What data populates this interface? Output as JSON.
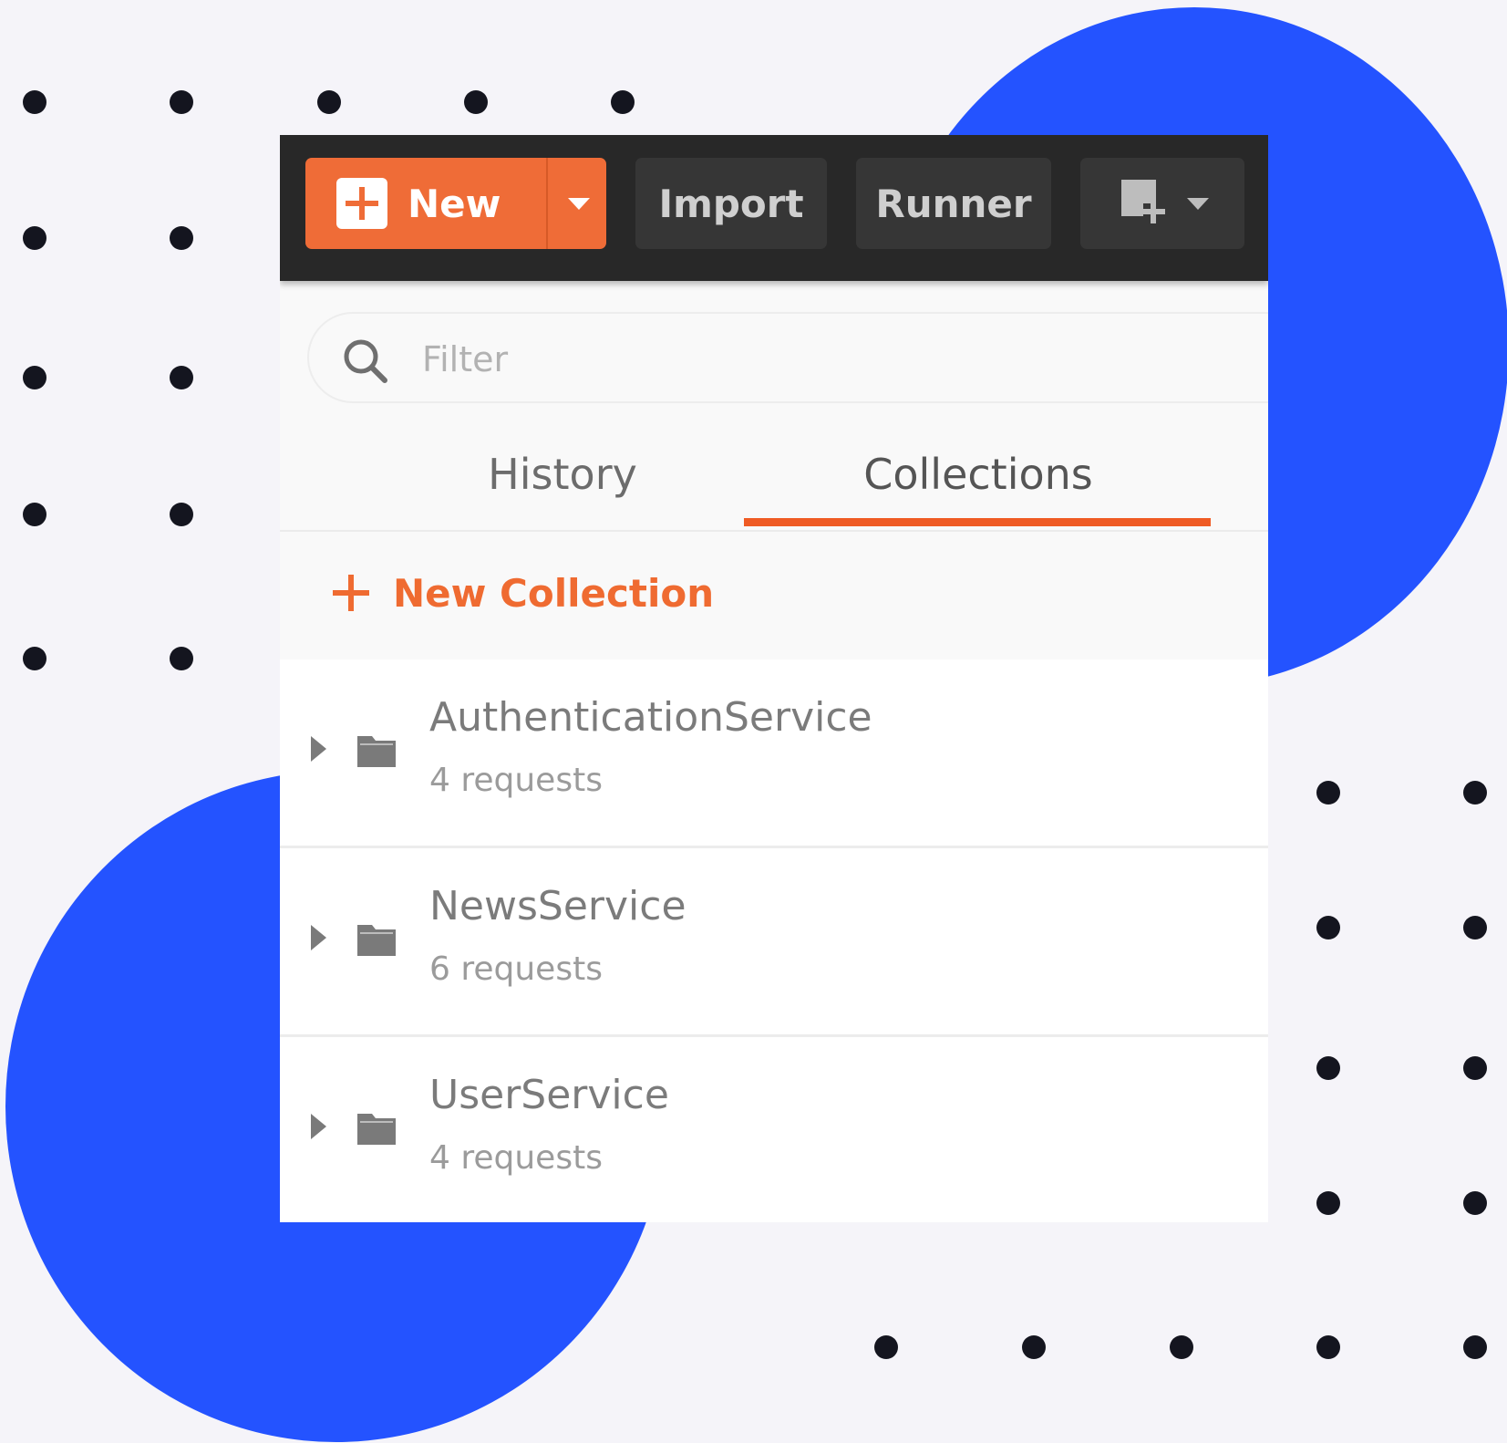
{
  "colors": {
    "background": "#f5f4f9",
    "blob": "#2453ff",
    "dots": "#14151f",
    "accent": "#ef6c37"
  },
  "toolbar": {
    "new_label": "New",
    "import_label": "Import",
    "runner_label": "Runner",
    "new_window_icon": "new-window-icon"
  },
  "search": {
    "placeholder": "Filter",
    "icon": "search-icon"
  },
  "tabs": [
    {
      "label": "History",
      "active": false
    },
    {
      "label": "Collections",
      "active": true
    }
  ],
  "actions": {
    "new_collection": "New Collection"
  },
  "collections": [
    {
      "name": "AuthenticationService",
      "count": "4 requests"
    },
    {
      "name": "NewsService",
      "count": "6 requests"
    },
    {
      "name": "UserService",
      "count": "4 requests"
    }
  ]
}
